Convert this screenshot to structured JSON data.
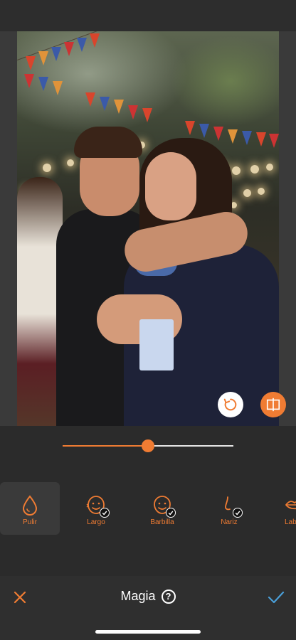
{
  "colors": {
    "accent": "#f07c33",
    "confirm": "#4a9fd8",
    "background": "#2b2b2b",
    "bottom_bar": "#2f2f2f"
  },
  "photo": {
    "description_icon": "photo-canvas"
  },
  "slider": {
    "value_fraction": 0.5
  },
  "tools": [
    {
      "label": "Pulir",
      "icon": "droplet-icon",
      "active": true,
      "applied": false
    },
    {
      "label": "Largo",
      "icon": "face-long-icon",
      "active": false,
      "applied": true
    },
    {
      "label": "Barbilla",
      "icon": "face-chin-icon",
      "active": false,
      "applied": true
    },
    {
      "label": "Nariz",
      "icon": "nose-icon",
      "active": false,
      "applied": true
    },
    {
      "label": "Lab",
      "icon": "lips-icon",
      "active": false,
      "applied": false
    }
  ],
  "footer": {
    "title": "Magia",
    "help_icon": "?"
  }
}
